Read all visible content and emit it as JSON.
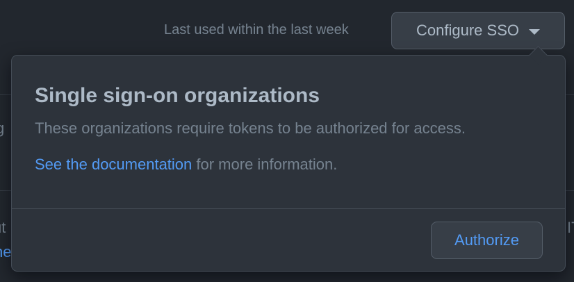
{
  "header": {
    "last_used": "Last used within the last week",
    "sso_button_label": "Configure SSO",
    "sso_button_icon": "caret-down-icon"
  },
  "popover": {
    "title": "Single sign-on organizations",
    "description": "These organizations require tokens to be authorized for access.",
    "link_text": "See the documentation",
    "info_suffix": " for more information.",
    "authorize_label": "Authorize"
  },
  "background": {
    "fragment_left_top": "g",
    "fragment_left_mid": "ut",
    "fragment_left_bottom": "he",
    "fragment_right": "IT"
  },
  "colors": {
    "page_bg": "#22272e",
    "popover_bg": "#2d333b",
    "border": "#444c56",
    "text_primary": "#adbac7",
    "text_muted": "#768390",
    "link": "#539bf5"
  }
}
